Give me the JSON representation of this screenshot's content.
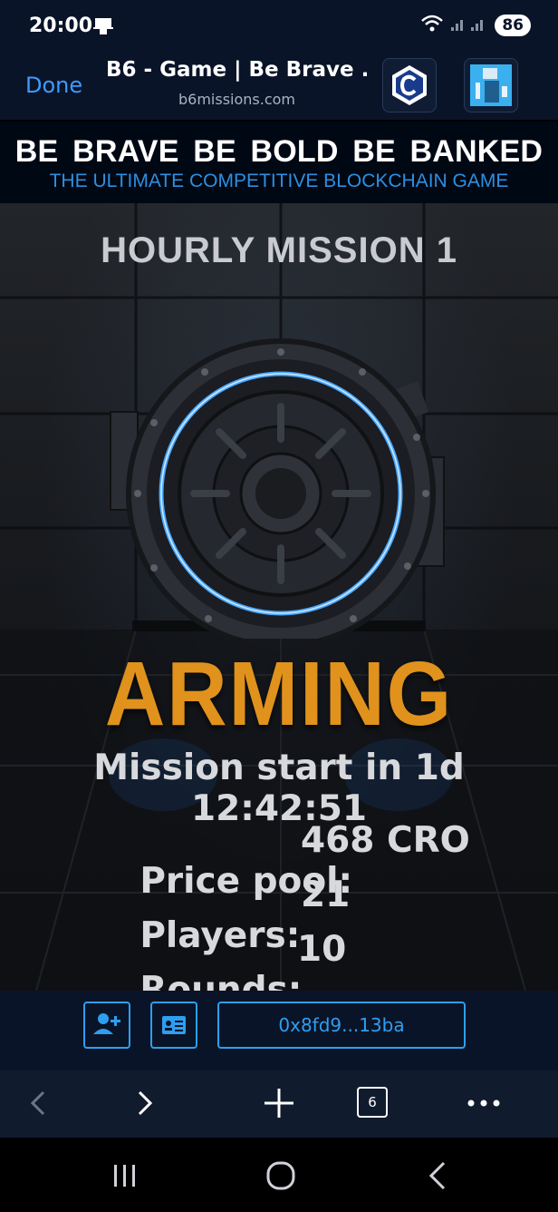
{
  "status_bar": {
    "time": "20:00",
    "battery": "86"
  },
  "browser": {
    "done_label": "Done",
    "tab_title": "B6 - Game | Be Brave ...",
    "url": "b6missions.com",
    "tabs_count": "6"
  },
  "banner": {
    "title": "BE BRAVE  BE BOLD  BE BANKED",
    "subtitle": "THE ULTIMATE COMPETITIVE BLOCKCHAIN GAME"
  },
  "game": {
    "mission_title": "HOURLY MISSION 1",
    "status": "ARMING",
    "countdown": "Mission start in 1d 12:42:51",
    "stats": [
      {
        "label": "Price pool:",
        "value": "468 CRO"
      },
      {
        "label": "Players:",
        "value": "21"
      },
      {
        "label": "Rounds:",
        "value": "10"
      }
    ]
  },
  "actions": {
    "wallet": "0x8fd9...13ba"
  },
  "colors": {
    "accent_blue": "#2e9ef0",
    "status_orange": "#e0921c",
    "dark_navy": "#0a1428"
  },
  "icons": [
    "cronos-icon",
    "avatar-icon",
    "add-user-icon",
    "id-card-icon",
    "back-icon",
    "forward-icon",
    "new-tab-icon",
    "more-icon"
  ]
}
